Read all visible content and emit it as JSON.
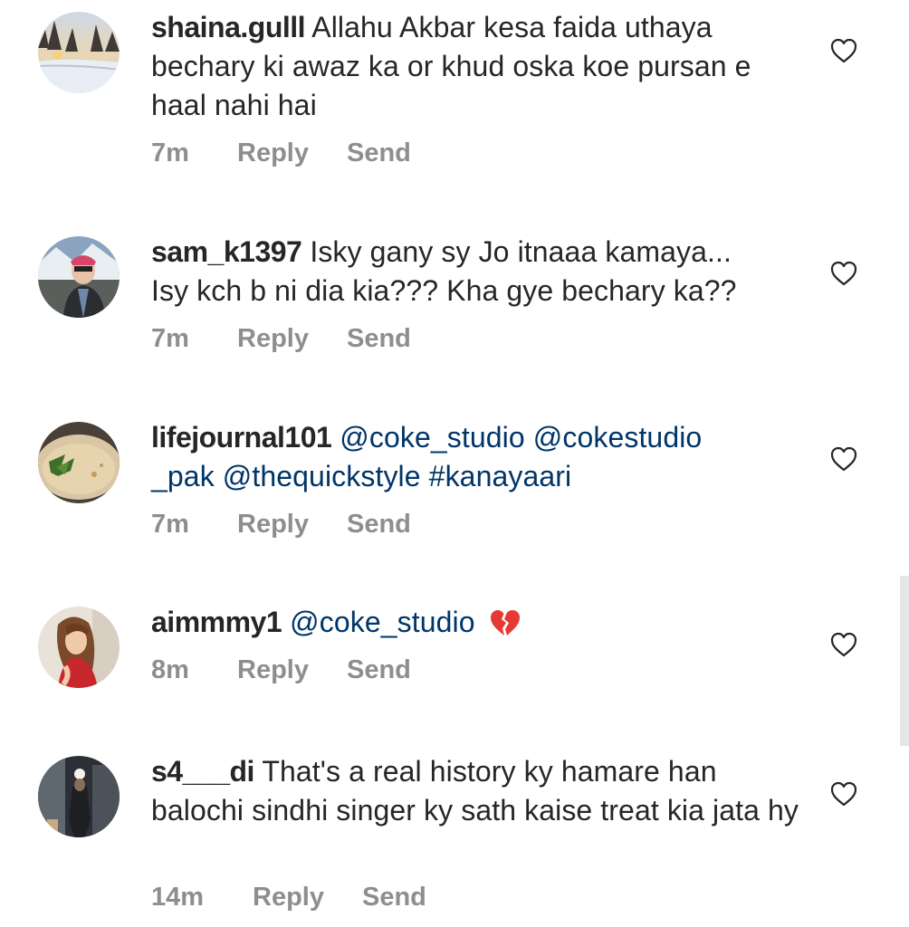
{
  "comments": [
    {
      "username": "shaina.gulll",
      "text": "Allahu Akbar kesa faida uthaya bechary ki awaz ka or khud oska koe pursan e haal nahi hai",
      "time": "7m",
      "reply_label": "Reply",
      "send_label": "Send"
    },
    {
      "username": "sam_k1397",
      "text_line1": "Isky gany sy Jo itnaaa kamaya...",
      "text_line2": "Isy kch b ni dia kia??? Kha gye bechary ka??",
      "time": "7m",
      "reply_label": "Reply",
      "send_label": "Send"
    },
    {
      "username": "lifejournal101",
      "mention_1": "@coke_studio",
      "mention_2a": "@cokestudio",
      "mention_2b": "_pak",
      "mention_3": "@thequickstyle",
      "hashtag": "#kanayaari",
      "time": "7m",
      "reply_label": "Reply",
      "send_label": "Send"
    },
    {
      "username": "aimmmy1",
      "mention_1": "@coke_studio",
      "emoji": "broken-heart",
      "time": "8m",
      "reply_label": "Reply",
      "send_label": "Send"
    },
    {
      "username": "s4___di",
      "text": "That's a real history ky hamare han balochi sindhi singer ky sath kaise treat kia jata hy",
      "time": "14m",
      "reply_label": "Reply",
      "send_label": "Send"
    }
  ],
  "icons": {
    "like": "heart-outline-icon"
  },
  "colors": {
    "text": "#262626",
    "meta": "#8e8e8e",
    "mention": "#003569",
    "broken_heart": "#e53935"
  }
}
